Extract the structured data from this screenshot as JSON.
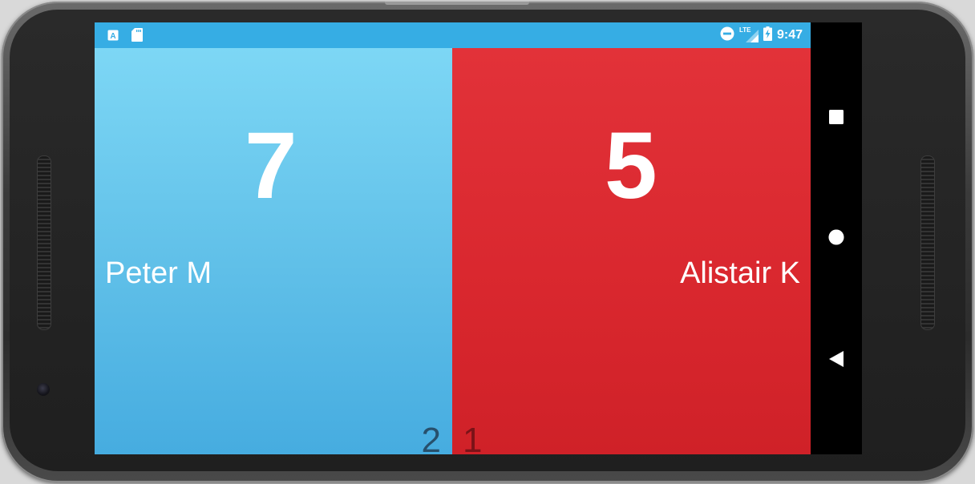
{
  "status_bar": {
    "time": "9:47",
    "network_label": "LTE",
    "left_icons": [
      "app-a-icon",
      "sd-card-icon"
    ],
    "right_icons": [
      "do-not-disturb-icon",
      "lte-signal-icon",
      "battery-charging-icon"
    ],
    "background": "#36ade4"
  },
  "players": {
    "left": {
      "name": "Peter M",
      "score": "7",
      "sets": "2",
      "color": "#5fbfe8"
    },
    "right": {
      "name": "Alistair K",
      "score": "5",
      "sets": "1",
      "color": "#d9272e"
    }
  },
  "nav_bar": {
    "buttons": [
      "recents-icon",
      "home-icon",
      "back-icon"
    ]
  }
}
